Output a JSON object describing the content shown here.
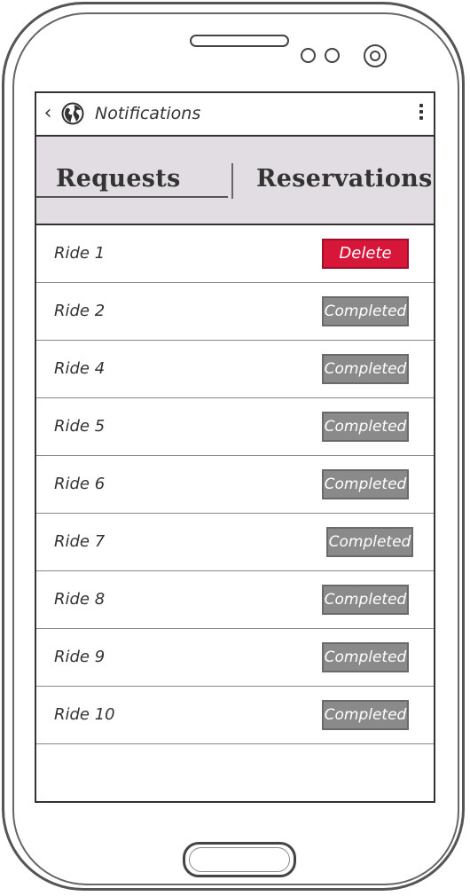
{
  "app_bar": {
    "title": "Notifications",
    "back_glyph": "‹",
    "icons": {
      "back": "chevron-left-icon",
      "globe": "globe-icon",
      "menu": "more-vertical-icon"
    }
  },
  "tabs": [
    {
      "label": "Requests",
      "selected": true
    },
    {
      "label": "Reservations",
      "selected": false
    }
  ],
  "rides": [
    {
      "label": "Ride 1",
      "action": "Delete",
      "type": "delete"
    },
    {
      "label": "Ride 2",
      "action": "Completed",
      "type": "completed"
    },
    {
      "label": "Ride 4",
      "action": "Completed",
      "type": "completed"
    },
    {
      "label": "Ride 5",
      "action": "Completed",
      "type": "completed"
    },
    {
      "label": "Ride 6",
      "action": "Completed",
      "type": "completed"
    },
    {
      "label": "Ride 7",
      "action": "Completed",
      "type": "completed"
    },
    {
      "label": "Ride 8",
      "action": "Completed",
      "type": "completed"
    },
    {
      "label": "Ride 9",
      "action": "Completed",
      "type": "completed"
    },
    {
      "label": "Ride 10",
      "action": "Completed",
      "type": "completed"
    }
  ],
  "colors": {
    "delete": "#d7163a",
    "completed": "#8a8a8a",
    "tab_background": "#e2dde2",
    "outline": "#333333"
  }
}
